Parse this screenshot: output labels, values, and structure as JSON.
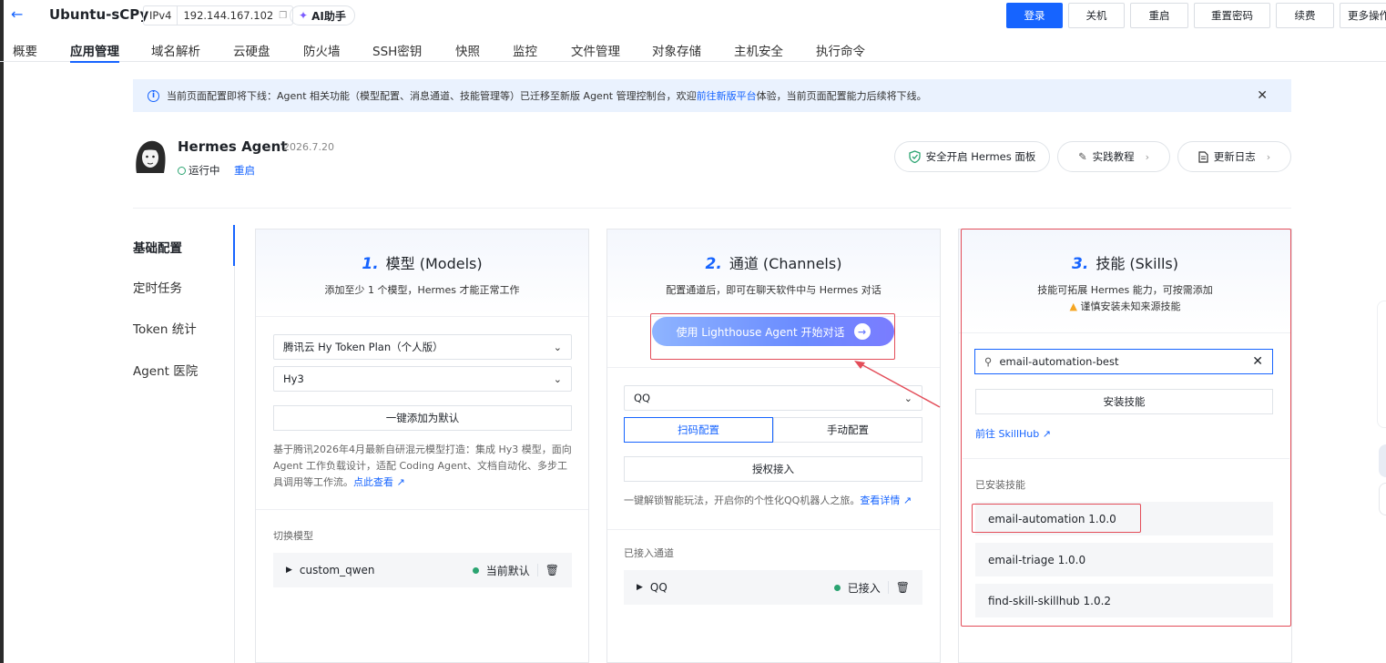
{
  "header": {
    "back_icon": "arrow-left-icon",
    "hostname": "Ubuntu-sCPy",
    "ip_type": "IPv4",
    "ip": "192.144.167.102",
    "copy_icon": "copy-icon",
    "ai_label": "AI助手",
    "buttons": [
      "登录",
      "关机",
      "重启",
      "重置密码",
      "续费",
      "更多操作"
    ]
  },
  "tabs": [
    "概要",
    "应用管理",
    "域名解析",
    "云硬盘",
    "防火墙",
    "SSH密钥",
    "快照",
    "监控",
    "文件管理",
    "对象存储",
    "主机安全",
    "执行命令"
  ],
  "active_tab": "应用管理",
  "notice": {
    "text_before": "当前页面配置即将下线：Agent 相关功能（模型配置、消息通道、技能管理等）已迁移至新版 Agent 管理控制台，欢迎",
    "link": "前往新版平台",
    "text_after": "体验，当前页面配置能力后续将下线。"
  },
  "agent": {
    "name": "Hermes Agent",
    "date": "2026.7.20",
    "status": "运行中",
    "restart": "重启",
    "actions": [
      "安全开启 Hermes 面板",
      "实践教程",
      "更新日志"
    ]
  },
  "sidenav": [
    "基础配置",
    "定时任务",
    "Token 统计",
    "Agent 医院"
  ],
  "models": {
    "num": "1.",
    "title": "模型 (Models)",
    "subtitle": "添加至少 1 个模型，Hermes 才能正常工作",
    "provider": "腾讯云 Hy Token Plan（个人版）",
    "model": "Hy3",
    "add_default": "一键添加为默认",
    "desc": "基于腾讯2026年4月最新自研混元模型打造：集成 Hy3 模型，面向 Agent 工作负载设计，适配 Coding Agent、文档自动化、多步工具调用等工作流。",
    "desc_link": "点此查看",
    "switch_label": "切换模型",
    "current_model": "custom_qwen",
    "current_default": "当前默认"
  },
  "channels": {
    "num": "2.",
    "title": "通道 (Channels)",
    "subtitle": "配置通道后，即可在聊天软件中与 Hermes 对话",
    "start_chat": "使用 Lighthouse Agent 开始对话",
    "channel": "QQ",
    "seg_scan": "扫码配置",
    "seg_manual": "手动配置",
    "authorize": "授权接入",
    "desc": "一键解锁智能玩法，开启你的个性化QQ机器人之旅。",
    "desc_link": "查看详情",
    "connected_label": "已接入通道",
    "connected_name": "QQ",
    "connected_status": "已接入"
  },
  "skills": {
    "num": "3.",
    "title": "技能 (Skills)",
    "subtitle": "技能可拓展 Hermes 能力，可按需添加",
    "warning": "谨慎安装未知来源技能",
    "search_value": "email-automation-best",
    "install": "安装技能",
    "skillhub_link": "前往 SkillHub",
    "installed_label": "已安装技能",
    "installed": [
      "email-automation 1.0.0",
      "email-triage 1.0.0",
      "find-skill-skillhub 1.0.2"
    ]
  }
}
